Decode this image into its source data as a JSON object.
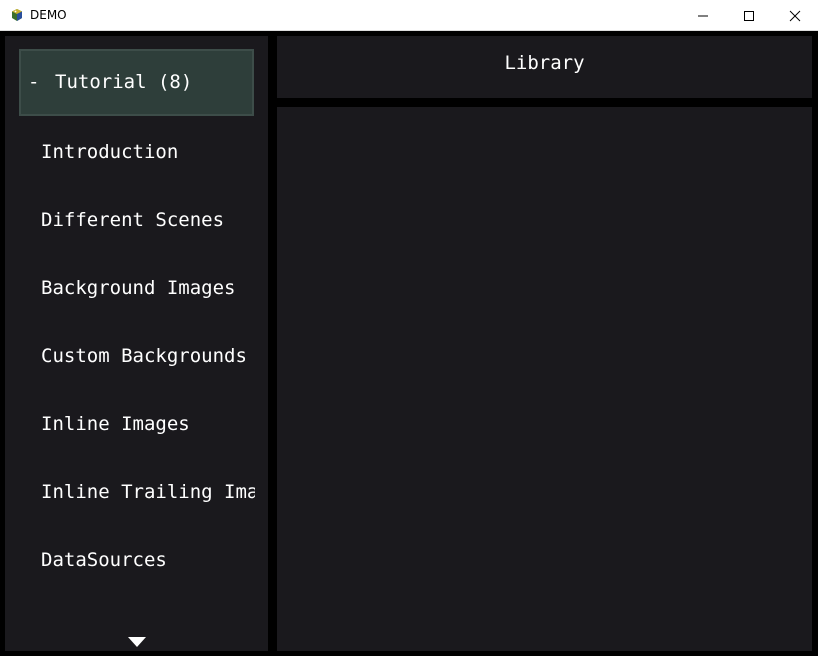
{
  "window": {
    "title": "DEMO",
    "app_icon": "python-icon",
    "controls": [
      "minimize-icon",
      "maximize-icon",
      "close-icon"
    ]
  },
  "sidebar": {
    "section": {
      "expander": "-",
      "label": "Tutorial (8)"
    },
    "items": [
      {
        "label": "Introduction"
      },
      {
        "label": "Different Scenes"
      },
      {
        "label": "Background Images"
      },
      {
        "label": "Custom Backgrounds"
      },
      {
        "label": "Inline Images"
      },
      {
        "label": "Inline Trailing Images"
      },
      {
        "label": "DataSources"
      }
    ],
    "scroll_icon": "triangle-down-icon"
  },
  "header": {
    "title": "Library"
  },
  "colors": {
    "background": "#000000",
    "panel": "#1a191d",
    "selected": "#2e3e3a",
    "text": "#ffffff"
  }
}
